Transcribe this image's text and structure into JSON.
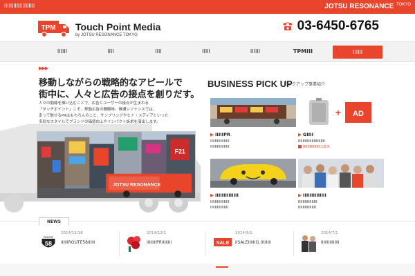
{
  "topbar": {
    "tagline": "ⅠⅠⅠⅠⅠⅠⅠⅠⅠⅠⅠⅠⅠⅠⅠⅠⅠⅠⅠⅠ",
    "brand": "JOTSU RESONANCE",
    "brand_suffix": "TOKYO"
  },
  "logo": {
    "mark_text": "TPM",
    "title": "Touch Point Media",
    "subtitle_prefix": "by JOTSU RESONANCE",
    "subtitle_suffix": "TOKYO"
  },
  "phone": {
    "number": "03-6450-6765",
    "icon": "phone-icon"
  },
  "nav": {
    "items": [
      "ⅠⅠⅠⅠⅠⅠ",
      "ⅠⅠⅠⅠ",
      "ⅠⅠⅠⅠ",
      "ⅠⅠⅠⅠⅠ",
      "ⅠⅠⅠⅠⅠⅠ",
      "TPMⅠⅠⅠ"
    ],
    "contact": "ⅠⅠⅠⅠⅠⅠ"
  },
  "hero": {
    "arrows": "▶▶▶",
    "headline_line1": "移動しながらの戦略的なアピールで",
    "headline_line2": "街中に、人々と広告の接点を創りだす。",
    "body_lines": [
      "人々の動線を掴い込むことで、広告とユーザーの接点が生まれる",
      "「タッチポイント」こそ、移動広告の醍醐味。佛通レゾナンスでは、",
      "走って魅せるPRはもちろんのこと、サンプリングやヒト・メディアといった",
      "多彩なスタイルでブランドの価値向上やインパクト訴求を演出します。"
    ],
    "banner_brand": "JOTSU RESONANCE"
  },
  "pickup": {
    "title": "BUSINESS PICK UP",
    "subtitle": "ピックアップ事業紹介",
    "cards": [
      {
        "caption": "ⅠⅠⅠⅠⅠPR",
        "desc1": "ⅠⅠⅠⅠⅠⅠⅠⅠⅠⅠⅠⅠⅠⅠⅠⅠⅠ",
        "desc2": "ⅠⅠⅠⅠⅠⅠⅠⅠⅠⅠⅠⅠⅠⅠⅠⅠⅠ",
        "link": ""
      },
      {
        "caption": "GⅠⅠⅠⅠ",
        "desc1": "ⅠⅠⅠⅠⅠⅠⅠⅠⅠⅠⅠⅠⅠⅠⅠⅠⅠⅠⅠⅠⅠⅠⅠⅠ",
        "desc2": "",
        "link": "ⅠⅠⅠⅠⅠⅠⅠⅠⅠⅠⅠⅠⅠⅠCLICK"
      },
      {
        "caption": "ⅠⅠⅠⅠⅠⅠⅠⅠⅠⅠⅠⅠⅠⅠ",
        "desc1": "ⅠⅠⅠⅠⅠⅠⅠⅠⅠⅠⅠⅠⅠⅠⅠⅠⅠ",
        "desc2": "ⅠⅠⅠⅠⅠⅠⅠⅠⅠⅠⅠⅠⅠⅠⅠⅠ",
        "link": ""
      },
      {
        "caption": "ⅠⅠⅠⅠⅠⅠⅠⅠⅠⅠⅠⅠⅠⅠ",
        "desc1": "ⅠⅠⅠⅠⅠⅠⅠⅠⅠⅠⅠⅠⅠⅠⅠⅠⅠ",
        "desc2": "ⅠⅠⅠⅠⅠⅠⅠⅠⅠⅠⅠⅠⅠⅠⅠⅠ",
        "link": ""
      }
    ],
    "ad_text": "AD"
  },
  "news": {
    "tab": "NEWS",
    "items": [
      {
        "date": "2014/12/18",
        "title": "ⅠⅠⅠⅠⅠⅠROUTE58ⅠⅠⅠⅠⅠⅠ",
        "thumb_text": "58",
        "thumb_top": "ROUTE"
      },
      {
        "date": "2014/12/1",
        "title": "ⅠⅠⅠⅠⅠⅠⅠⅠPRⅠⅠⅠⅠⅠⅠⅠⅠ",
        "thumb_text": ""
      },
      {
        "date": "2014/9/1",
        "title": "ⅠⅠSALEⅠⅠⅠⅠⅠⅠⅠ1.0tⅠⅠⅠⅠⅠ",
        "thumb_text": "SALE"
      },
      {
        "date": "2014/7/1",
        "title": "ⅠⅠⅠⅠⅠⅠⅠⅠⅠⅠⅠⅠⅠⅠⅠ",
        "thumb_text": ""
      }
    ]
  },
  "colors": {
    "accent": "#e8452c",
    "nav_bg": "#f2f2f2",
    "text": "#222222"
  }
}
